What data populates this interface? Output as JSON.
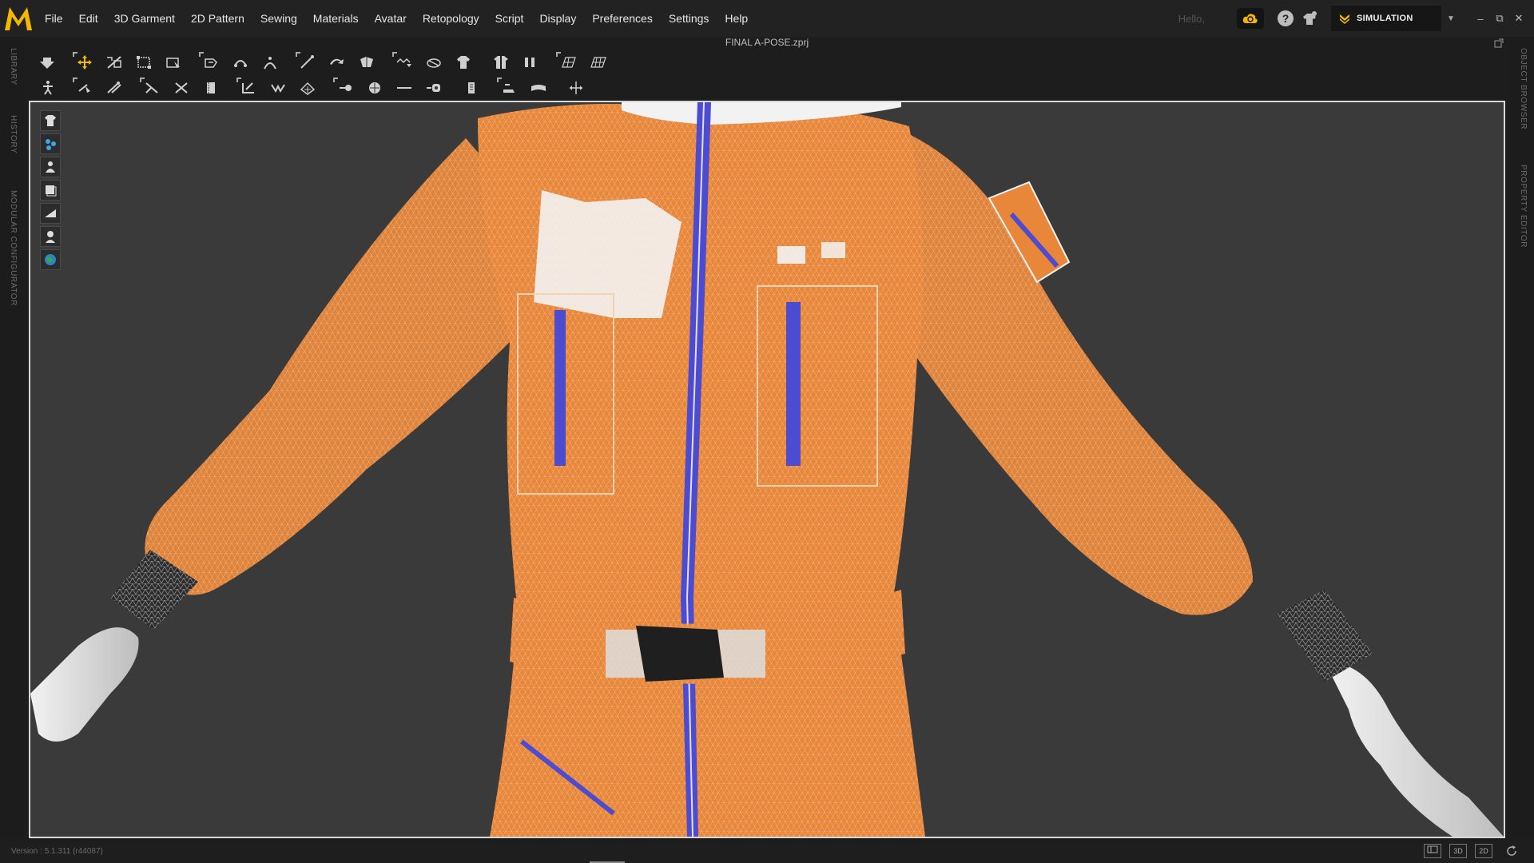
{
  "menu": {
    "items": [
      "File",
      "Edit",
      "3D Garment",
      "2D Pattern",
      "Sewing",
      "Materials",
      "Avatar",
      "Retopology",
      "Script",
      "Display",
      "Preferences",
      "Settings",
      "Help"
    ],
    "greeting": "Hello,",
    "mode": "SIMULATION"
  },
  "window": {
    "file_title": "FINAL A-POSE.zprj",
    "minimize": "–",
    "restore": "⧉",
    "close": "✕"
  },
  "side_tabs": {
    "left": [
      "LIBRARY",
      "HISTORY",
      "MODULAR CONFIGURATOR"
    ],
    "right": [
      "OBJECT BROWSER",
      "PROPERTY EDITOR"
    ]
  },
  "status": {
    "version": "Version : 5.1.311 (r44087)",
    "view_modes": [
      "3D",
      "2D"
    ]
  },
  "icons": {
    "toolbar1": [
      "pin-down-icon",
      "select-move-icon",
      "transform-pattern-icon",
      "bounding-box-icon",
      "select-mesh-icon",
      "fold-arrange-icon",
      "tack-icon",
      "tack-on-avatar-icon",
      "edit-curvature-icon",
      "fold-icon",
      "remove-tack-icon",
      "steam-icon",
      "shrinkage-icon",
      "shirt-flip-icon",
      "garment-mirror-icon",
      "grid-surface-icon",
      "mesh-grid-icon"
    ],
    "toolbar2": [
      "avatar-pose-icon",
      "pin-icon",
      "pin-cage-icon",
      "edit-sewing-icon",
      "free-sewing-icon",
      "topstitch-icon",
      "button-icon",
      "buttonhole-icon",
      "gather-icon",
      "puckering-icon",
      "circle-tool-icon",
      "line-measure-icon",
      "zipper-icon",
      "tape-icon",
      "trim-icon",
      "fabric-bend-icon",
      "transfer-icon"
    ],
    "view_tools": [
      "shirt-view-icon",
      "molecule-icon",
      "avatar-view-icon",
      "layers-icon",
      "texture-icon",
      "bust-icon",
      "globe-icon"
    ]
  },
  "colors": {
    "accent": "#f5b800",
    "garment_mesh": "#e8873a",
    "zipper": "#4d4bd0",
    "viewport_bg": "#3a3a3a"
  }
}
